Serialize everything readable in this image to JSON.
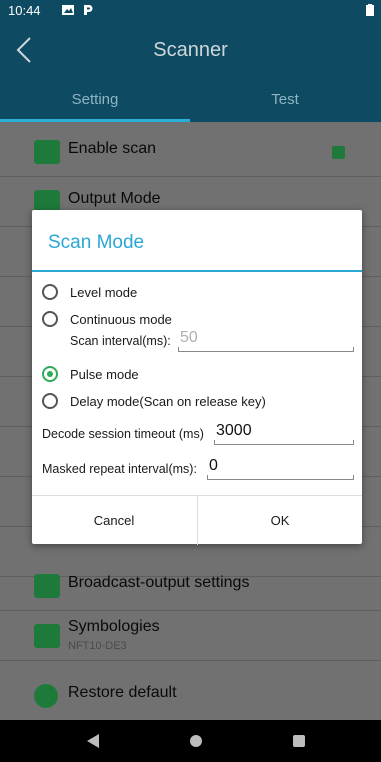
{
  "status_bar": {
    "time": "10:44"
  },
  "app_bar": {
    "title": "Scanner"
  },
  "tabs": [
    {
      "label": "Setting"
    },
    {
      "label": "Test"
    }
  ],
  "settings_list": [
    {
      "label": "Enable scan",
      "icon": "scan-icon",
      "checked": true
    },
    {
      "label": "Output Mode",
      "icon": "output-icon"
    },
    {
      "label": "Broadcast-output settings",
      "icon": "output-icon"
    },
    {
      "label": "Symbologies",
      "sublabel": "NFT10-DE3",
      "icon": "sliders-icon"
    },
    {
      "label": "Restore default",
      "icon": "clock-icon"
    }
  ],
  "dialog": {
    "title": "Scan Mode",
    "options": [
      {
        "label": "Level mode",
        "selected": false
      },
      {
        "label": "Continuous mode",
        "selected": false
      },
      {
        "label": "Pulse mode",
        "selected": true
      },
      {
        "label": "Delay mode(Scan on release key)",
        "selected": false
      }
    ],
    "scan_interval": {
      "label": "Scan interval(ms):",
      "value": "50"
    },
    "decode_timeout": {
      "label": "Decode session timeout (ms)",
      "value": "3000"
    },
    "masked_repeat": {
      "label": "Masked repeat interval(ms):",
      "value": "0"
    },
    "cancel_label": "Cancel",
    "ok_label": "OK"
  },
  "colors": {
    "primary": "#0f4a63",
    "accent": "#2aa7d4",
    "radio_selected": "#2eaa58",
    "list_icon": "#1e7a3a"
  }
}
